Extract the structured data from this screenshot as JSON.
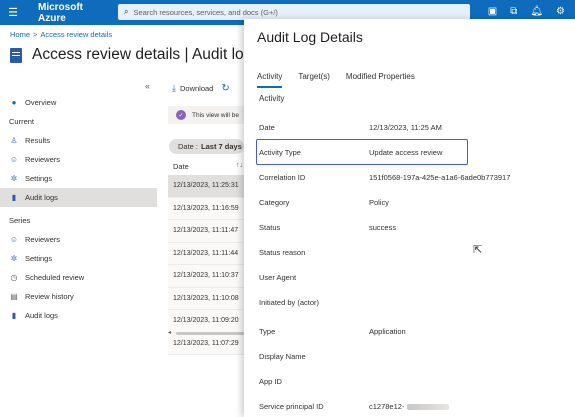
{
  "topbar": {
    "brand": "Microsoft Azure",
    "search_placeholder": "Search resources, services, and docs (G+/)"
  },
  "breadcrumb": {
    "home": "Home",
    "current": "Access review details"
  },
  "blade": {
    "title": "Access review details | Audit logs",
    "collapse": "«"
  },
  "nav": {
    "overview": "Overview",
    "current_header": "Current",
    "results": "Results",
    "reviewers": "Reviewers",
    "settings": "Settings",
    "audit_logs": "Audit logs",
    "series_header": "Series",
    "series_reviewers": "Reviewers",
    "series_settings": "Settings",
    "scheduled_review": "Scheduled review",
    "review_history": "Review history",
    "series_audit_logs": "Audit logs"
  },
  "list": {
    "download": "Download",
    "info": "This view will be",
    "filter_label": "Date :",
    "filter_value": "Last 7 days",
    "col_date": "Date",
    "rows": [
      "12/13/2023, 11:25:31",
      "12/13/2023, 11:16:59",
      "12/13/2023, 11:11:47",
      "12/13/2023, 11:11:44",
      "12/13/2023, 11:10:37",
      "12/13/2023, 11:10:08",
      "12/13/2023, 11:09:20",
      "12/13/2023, 11:07:29"
    ]
  },
  "panel": {
    "title": "Audit Log Details",
    "tabs": [
      "Activity",
      "Target(s)",
      "Modified Properties"
    ],
    "section": "Activity",
    "fields": [
      {
        "key": "Date",
        "value": "12/13/2023, 11:25 AM"
      },
      {
        "key": "Activity Type",
        "value": "Update access review"
      },
      {
        "key": "Correlation ID",
        "value": "151f0568-197a-425e-a1a6-6ade0b773917"
      },
      {
        "key": "Category",
        "value": "Policy"
      },
      {
        "key": "Status",
        "value": "success"
      },
      {
        "key": "Status reason",
        "value": ""
      },
      {
        "key": "User Agent",
        "value": ""
      },
      {
        "key": "Initiated by (actor)",
        "value": ""
      },
      {
        "key": "Type",
        "value": "Application"
      },
      {
        "key": "Display Name",
        "value": ""
      },
      {
        "key": "App ID",
        "value": ""
      },
      {
        "key": "Service principal ID",
        "value": "c1278e12-"
      }
    ]
  }
}
